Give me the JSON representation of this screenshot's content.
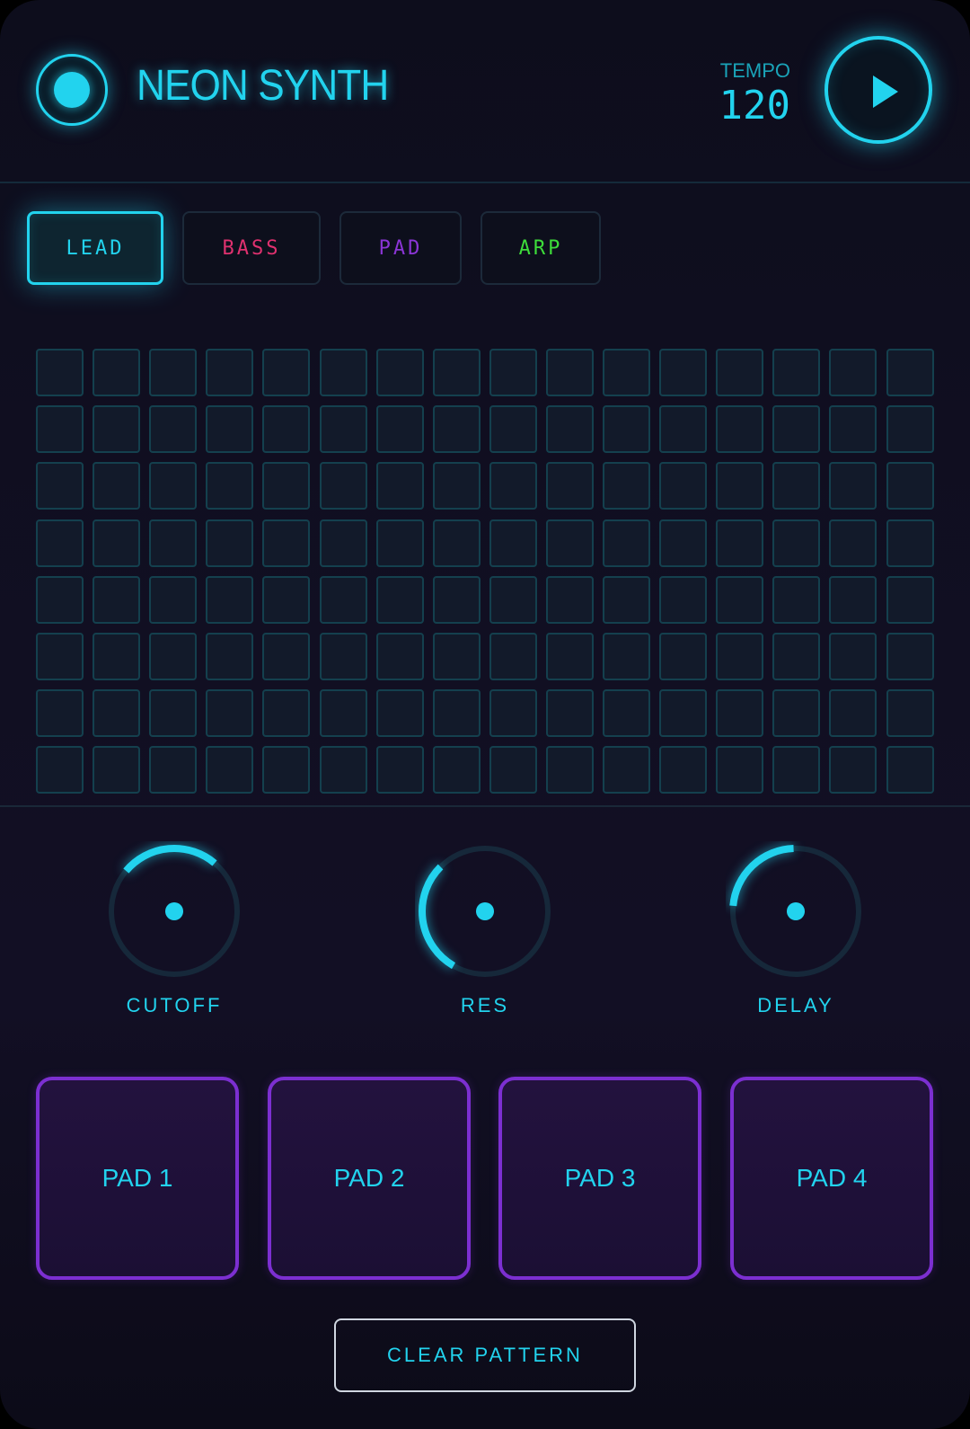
{
  "header": {
    "title": "NEON SYNTH",
    "tempo_label": "TEMPO",
    "tempo_value": "120",
    "power_icon": "power-icon",
    "play_icon": "play-icon"
  },
  "tabs": [
    {
      "label": "LEAD",
      "color": "#22d3ee",
      "active": true
    },
    {
      "label": "BASS",
      "color": "#e0316f",
      "active": false
    },
    {
      "label": "PAD",
      "color": "#8b35d6",
      "active": false
    },
    {
      "label": "ARP",
      "color": "#3ddc3a",
      "active": false
    }
  ],
  "sequencer": {
    "rows": 8,
    "columns": 16,
    "active_steps": []
  },
  "knobs": [
    {
      "label": "CUTOFF",
      "level": 0.5
    },
    {
      "label": "RES",
      "level": 0.25
    },
    {
      "label": "DELAY",
      "level": 0.3
    }
  ],
  "pads": [
    {
      "label": "PAD 1"
    },
    {
      "label": "PAD 2"
    },
    {
      "label": "PAD 3"
    },
    {
      "label": "PAD 4"
    }
  ],
  "actions": {
    "clear_label": "CLEAR PATTERN"
  },
  "colors": {
    "accent": "#22d3ee",
    "pad_border": "#7c2fd1",
    "background": "#0d0d1c"
  }
}
